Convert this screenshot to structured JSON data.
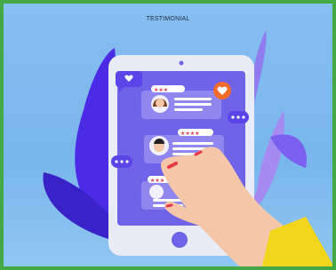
{
  "header": {
    "title": "TESTIMONIAL"
  },
  "illustration": {
    "subject": "tablet-with-customer-reviews",
    "review_cards": [
      {
        "stars": 3,
        "icon": "woman-avatar-icon"
      },
      {
        "stars": 4,
        "icon": "man-avatar-icon"
      },
      {
        "stars": 3,
        "icon": "avatar-icon"
      }
    ],
    "colors": {
      "frame_border": "#44a845",
      "background": "#86bff0",
      "tablet_body": "#e9ecf6",
      "tablet_screen": "#6f63e8",
      "leaf_dark": "#4b2be6",
      "leaf_light": "#a58af2",
      "star": "#e43a4a",
      "sleeve": "#f3d61b",
      "hand": "#f5c6a8",
      "heart_badge": "#f06b2c"
    }
  }
}
